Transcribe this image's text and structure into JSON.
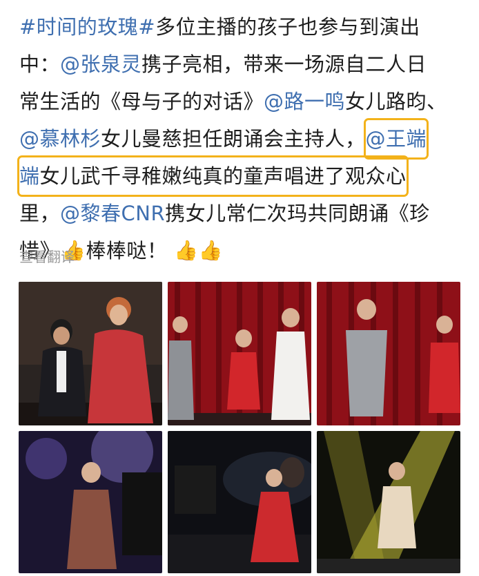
{
  "post": {
    "hashtag": "#时间的玫瑰#",
    "line1_text": " 多位主播的孩子也参与到演出",
    "line2_prefix": "中：",
    "mention_zhang": "@张泉灵",
    "line2_text": " 携子亮相，带来一场源自二人日",
    "line3_text": "常生活的《母与子的对话》",
    "mention_lu": "@路一鸣",
    "line3_suffix": " 女儿路昀、",
    "mention_mu": "@慕林杉",
    "line4_text": " 女儿曼慈担任朗诵会主持人，",
    "mention_wang_part1": "@王端",
    "mention_wang_part2": "端",
    "line5_text": " 女儿武千寻稚嫩纯真的童声唱进了观众心",
    "line6_prefix": "里，",
    "mention_li": "@黎春CNR",
    "line6_text": " 携女儿常仁次玛共同朗诵《珍",
    "line7_text": "惜》",
    "line7_mid": "棒棒哒！"
  },
  "translate_label": "查看翻译",
  "photos": [
    {
      "name": "photo-mother-son-stage"
    },
    {
      "name": "photo-three-girls-red-curtain"
    },
    {
      "name": "photo-two-girls-red-curtain"
    },
    {
      "name": "photo-girl-singing-purple-lights"
    },
    {
      "name": "photo-woman-red-dress-dark-stage"
    },
    {
      "name": "photo-girl-singing-spotlight"
    }
  ],
  "colors": {
    "link": "#3f6fb0",
    "highlight": "#f3b21a",
    "text": "#1e1e1e",
    "muted": "#999999"
  }
}
